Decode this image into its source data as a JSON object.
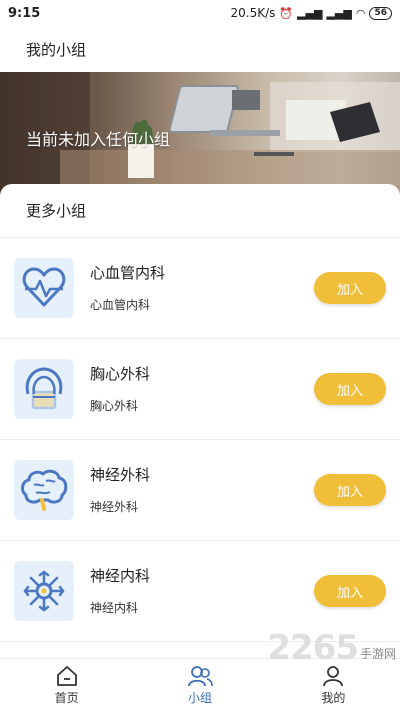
{
  "status_bar": {
    "time": "9:15",
    "speed": "20.5K/s",
    "battery": "56"
  },
  "header": {
    "title": "我的小组"
  },
  "banner": {
    "message": "当前未加入任何小组"
  },
  "more": {
    "title": "更多小组"
  },
  "groups": [
    {
      "name": "心血管内科",
      "subtitle": "心血管内科",
      "button": "加入",
      "icon": "heart-pulse-icon"
    },
    {
      "name": "胸心外科",
      "subtitle": "胸心外科",
      "button": "加入",
      "icon": "chest-icon"
    },
    {
      "name": "神经外科",
      "subtitle": "神经外科",
      "button": "加入",
      "icon": "brain-icon"
    },
    {
      "name": "神经内科",
      "subtitle": "神经内科",
      "button": "加入",
      "icon": "neuron-icon"
    }
  ],
  "tabs": [
    {
      "label": "首页",
      "icon": "home-icon"
    },
    {
      "label": "小组",
      "icon": "group-icon",
      "active": true
    },
    {
      "label": "我的",
      "icon": "user-icon"
    }
  ],
  "watermark": {
    "logo": "2265",
    "site": "手游网"
  },
  "colors": {
    "accent": "#f1be3a",
    "icon_bg": "#e6f0fb",
    "icon_stroke": "#4a78c2",
    "active_tab": "#3d6bb5"
  }
}
